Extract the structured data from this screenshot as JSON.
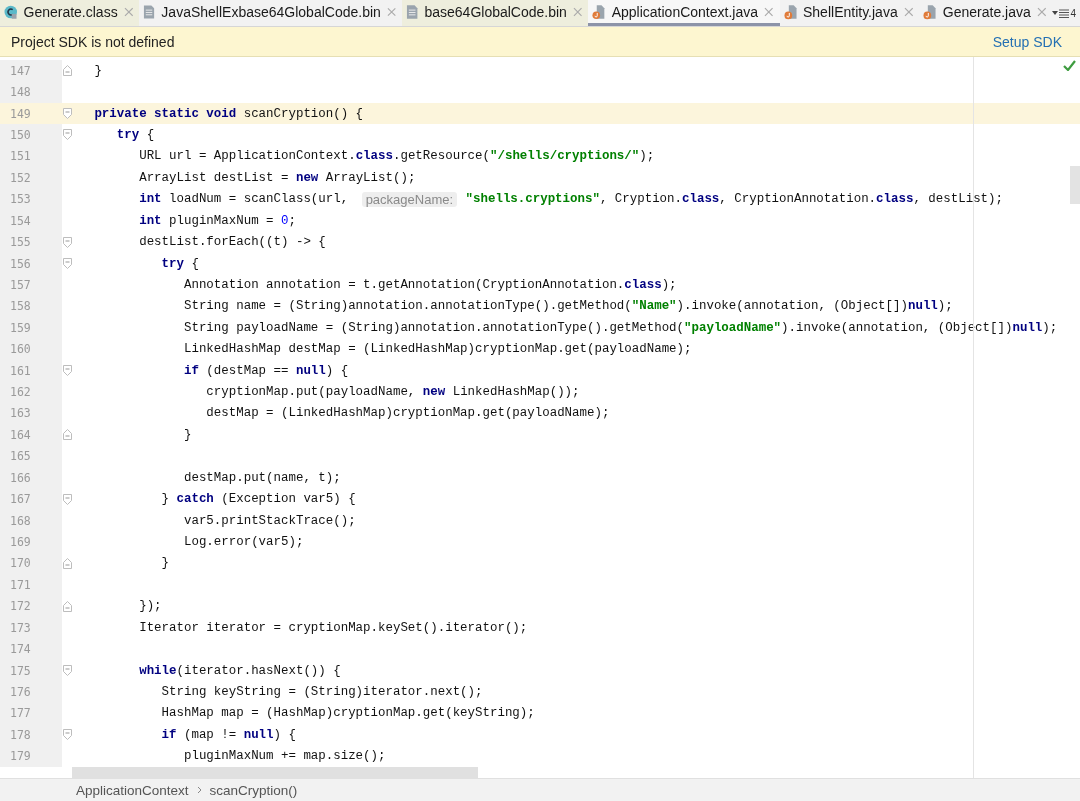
{
  "tabs": [
    {
      "label": "Generate.class",
      "kind": "class",
      "color": "#eeeedd",
      "selected": false
    },
    {
      "label": "JavaShellExbase64GlobalCode.bin",
      "kind": "bin",
      "color": "#f2f2f2",
      "selected": false
    },
    {
      "label": "base64GlobalCode.bin",
      "kind": "bin",
      "color": "#eeeedd",
      "selected": false
    },
    {
      "label": "ApplicationContext.java",
      "kind": "java",
      "color": "#f7f7f7",
      "selected": true
    },
    {
      "label": "ShellEntity.java",
      "kind": "java",
      "color": "#f2f2f2",
      "selected": false
    },
    {
      "label": "Generate.java",
      "kind": "java",
      "color": "#f2f2f2",
      "selected": false
    }
  ],
  "tab_overflow": {
    "count": "4"
  },
  "banner": {
    "message": "Project SDK is not defined",
    "action": "Setup SDK"
  },
  "editor": {
    "lines": [
      {
        "number": "147",
        "kind": "fold-end",
        "current": false,
        "tokens": [
          {
            "text": "   }",
            "kind": "plain"
          }
        ]
      },
      {
        "number": "148",
        "kind": "plain",
        "current": false
      },
      {
        "number": "149",
        "kind": "fold-start",
        "current": true,
        "tokens": [
          {
            "text": "   private static void",
            "kind": "keyword"
          },
          {
            "text": " scanCryption() {",
            "kind": "plain"
          }
        ]
      },
      {
        "number": "150",
        "kind": "fold-start",
        "current": false,
        "tokens": [
          {
            "text": "      try",
            "kind": "keyword"
          },
          {
            "text": " {",
            "kind": "plain"
          }
        ]
      },
      {
        "number": "151",
        "kind": "plain",
        "current": false,
        "tokens": [
          {
            "text": "         URL url = ApplicationContext.",
            "kind": "plain"
          },
          {
            "text": "class",
            "kind": "keyword"
          },
          {
            "text": ".getResource(",
            "kind": "plain"
          },
          {
            "text": "\"/shells/cryptions/\"",
            "kind": "string"
          },
          {
            "text": ");",
            "kind": "plain"
          }
        ]
      },
      {
        "number": "152",
        "kind": "plain",
        "current": false,
        "tokens": [
          {
            "text": "         ArrayList destList = ",
            "kind": "plain"
          },
          {
            "text": "new",
            "kind": "keyword"
          },
          {
            "text": " ArrayList();",
            "kind": "plain"
          }
        ]
      },
      {
        "number": "153",
        "kind": "plain",
        "current": false,
        "tokens": [
          {
            "text": "         int",
            "kind": "keyword"
          },
          {
            "text": " loadNum = scanClass(url, ",
            "kind": "plain"
          },
          {
            "text": "packageName:",
            "kind": "hint"
          },
          {
            "text": " \"shells.cryptions\"",
            "kind": "string"
          },
          {
            "text": ", Cryption.",
            "kind": "plain"
          },
          {
            "text": "class",
            "kind": "keyword"
          },
          {
            "text": ", CryptionAnnotation.",
            "kind": "plain"
          },
          {
            "text": "class",
            "kind": "keyword"
          },
          {
            "text": ", destList);",
            "kind": "plain"
          }
        ]
      },
      {
        "number": "154",
        "kind": "plain",
        "current": false,
        "tokens": [
          {
            "text": "         int",
            "kind": "keyword"
          },
          {
            "text": " pluginMaxNum = ",
            "kind": "plain"
          },
          {
            "text": "0",
            "kind": "number"
          },
          {
            "text": ";",
            "kind": "plain"
          }
        ]
      },
      {
        "number": "155",
        "kind": "fold-start",
        "current": false,
        "tokens": [
          {
            "text": "         destList.forEach((t) -> {",
            "kind": "plain"
          }
        ]
      },
      {
        "number": "156",
        "kind": "fold-start",
        "current": false,
        "tokens": [
          {
            "text": "            try",
            "kind": "keyword"
          },
          {
            "text": " {",
            "kind": "plain"
          }
        ]
      },
      {
        "number": "157",
        "kind": "plain",
        "current": false,
        "tokens": [
          {
            "text": "               Annotation annotation = t.getAnnotation(CryptionAnnotation.",
            "kind": "plain"
          },
          {
            "text": "class",
            "kind": "keyword"
          },
          {
            "text": ");",
            "kind": "plain"
          }
        ]
      },
      {
        "number": "158",
        "kind": "plain",
        "current": false,
        "tokens": [
          {
            "text": "               String name = (String)annotation.annotationType().getMethod(",
            "kind": "plain"
          },
          {
            "text": "\"Name\"",
            "kind": "string"
          },
          {
            "text": ").invoke(annotation, (Object[])",
            "kind": "plain"
          },
          {
            "text": "null",
            "kind": "keyword"
          },
          {
            "text": ");",
            "kind": "plain"
          }
        ]
      },
      {
        "number": "159",
        "kind": "plain",
        "current": false,
        "tokens": [
          {
            "text": "               String payloadName = (String)annotation.annotationType().getMethod(",
            "kind": "plain"
          },
          {
            "text": "\"payloadName\"",
            "kind": "string"
          },
          {
            "text": ").invoke(annotation, (Object[])",
            "kind": "plain"
          },
          {
            "text": "null",
            "kind": "keyword"
          },
          {
            "text": ");",
            "kind": "plain"
          }
        ]
      },
      {
        "number": "160",
        "kind": "plain",
        "current": false,
        "tokens": [
          {
            "text": "               LinkedHashMap destMap = (LinkedHashMap)cryptionMap.get(payloadName);",
            "kind": "plain"
          }
        ]
      },
      {
        "number": "161",
        "kind": "fold-start",
        "current": false,
        "tokens": [
          {
            "text": "               if",
            "kind": "keyword"
          },
          {
            "text": " (destMap == ",
            "kind": "plain"
          },
          {
            "text": "null",
            "kind": "keyword"
          },
          {
            "text": ") {",
            "kind": "plain"
          }
        ]
      },
      {
        "number": "162",
        "kind": "plain",
        "current": false,
        "tokens": [
          {
            "text": "                  cryptionMap.put(payloadName, ",
            "kind": "plain"
          },
          {
            "text": "new",
            "kind": "keyword"
          },
          {
            "text": " LinkedHashMap());",
            "kind": "plain"
          }
        ]
      },
      {
        "number": "163",
        "kind": "plain",
        "current": false,
        "tokens": [
          {
            "text": "                  destMap = (LinkedHashMap)cryptionMap.get(payloadName);",
            "kind": "plain"
          }
        ]
      },
      {
        "number": "164",
        "kind": "fold-end",
        "current": false,
        "tokens": [
          {
            "text": "               }",
            "kind": "plain"
          }
        ]
      },
      {
        "number": "165",
        "kind": "plain",
        "current": false
      },
      {
        "number": "166",
        "kind": "plain",
        "current": false,
        "tokens": [
          {
            "text": "               destMap.put(name, t);",
            "kind": "plain"
          }
        ]
      },
      {
        "number": "167",
        "kind": "fold-start",
        "current": false,
        "tokens": [
          {
            "text": "            } ",
            "kind": "plain"
          },
          {
            "text": "catch",
            "kind": "keyword"
          },
          {
            "text": " (Exception var5) {",
            "kind": "plain"
          }
        ]
      },
      {
        "number": "168",
        "kind": "plain",
        "current": false,
        "tokens": [
          {
            "text": "               var5.printStackTrace();",
            "kind": "plain"
          }
        ]
      },
      {
        "number": "169",
        "kind": "plain",
        "current": false,
        "tokens": [
          {
            "text": "               Log.error(var5);",
            "kind": "plain"
          }
        ]
      },
      {
        "number": "170",
        "kind": "fold-end",
        "current": false,
        "tokens": [
          {
            "text": "            }",
            "kind": "plain"
          }
        ]
      },
      {
        "number": "171",
        "kind": "plain",
        "current": false
      },
      {
        "number": "172",
        "kind": "fold-end",
        "current": false,
        "tokens": [
          {
            "text": "         });",
            "kind": "plain"
          }
        ]
      },
      {
        "number": "173",
        "kind": "plain",
        "current": false,
        "tokens": [
          {
            "text": "         Iterator iterator = cryptionMap.keySet().iterator();",
            "kind": "plain"
          }
        ]
      },
      {
        "number": "174",
        "kind": "plain",
        "current": false
      },
      {
        "number": "175",
        "kind": "fold-start",
        "current": false,
        "tokens": [
          {
            "text": "         while",
            "kind": "keyword"
          },
          {
            "text": "(iterator.hasNext()) {",
            "kind": "plain"
          }
        ]
      },
      {
        "number": "176",
        "kind": "plain",
        "current": false,
        "tokens": [
          {
            "text": "            String keyString = (String)iterator.next();",
            "kind": "plain"
          }
        ]
      },
      {
        "number": "177",
        "kind": "plain",
        "current": false,
        "tokens": [
          {
            "text": "            HashMap map = (HashMap)cryptionMap.get(keyString);",
            "kind": "plain"
          }
        ]
      },
      {
        "number": "178",
        "kind": "fold-start",
        "current": false,
        "tokens": [
          {
            "text": "            if",
            "kind": "keyword"
          },
          {
            "text": " (map != ",
            "kind": "plain"
          },
          {
            "text": "null",
            "kind": "keyword"
          },
          {
            "text": ") {",
            "kind": "plain"
          }
        ]
      },
      {
        "number": "179",
        "kind": "plain",
        "current": false,
        "tokens": [
          {
            "text": "               pluginMaxNum += map.size();",
            "kind": "plain"
          }
        ]
      }
    ]
  },
  "breadcrumbs": [
    "ApplicationContext",
    "scanCryption()"
  ]
}
